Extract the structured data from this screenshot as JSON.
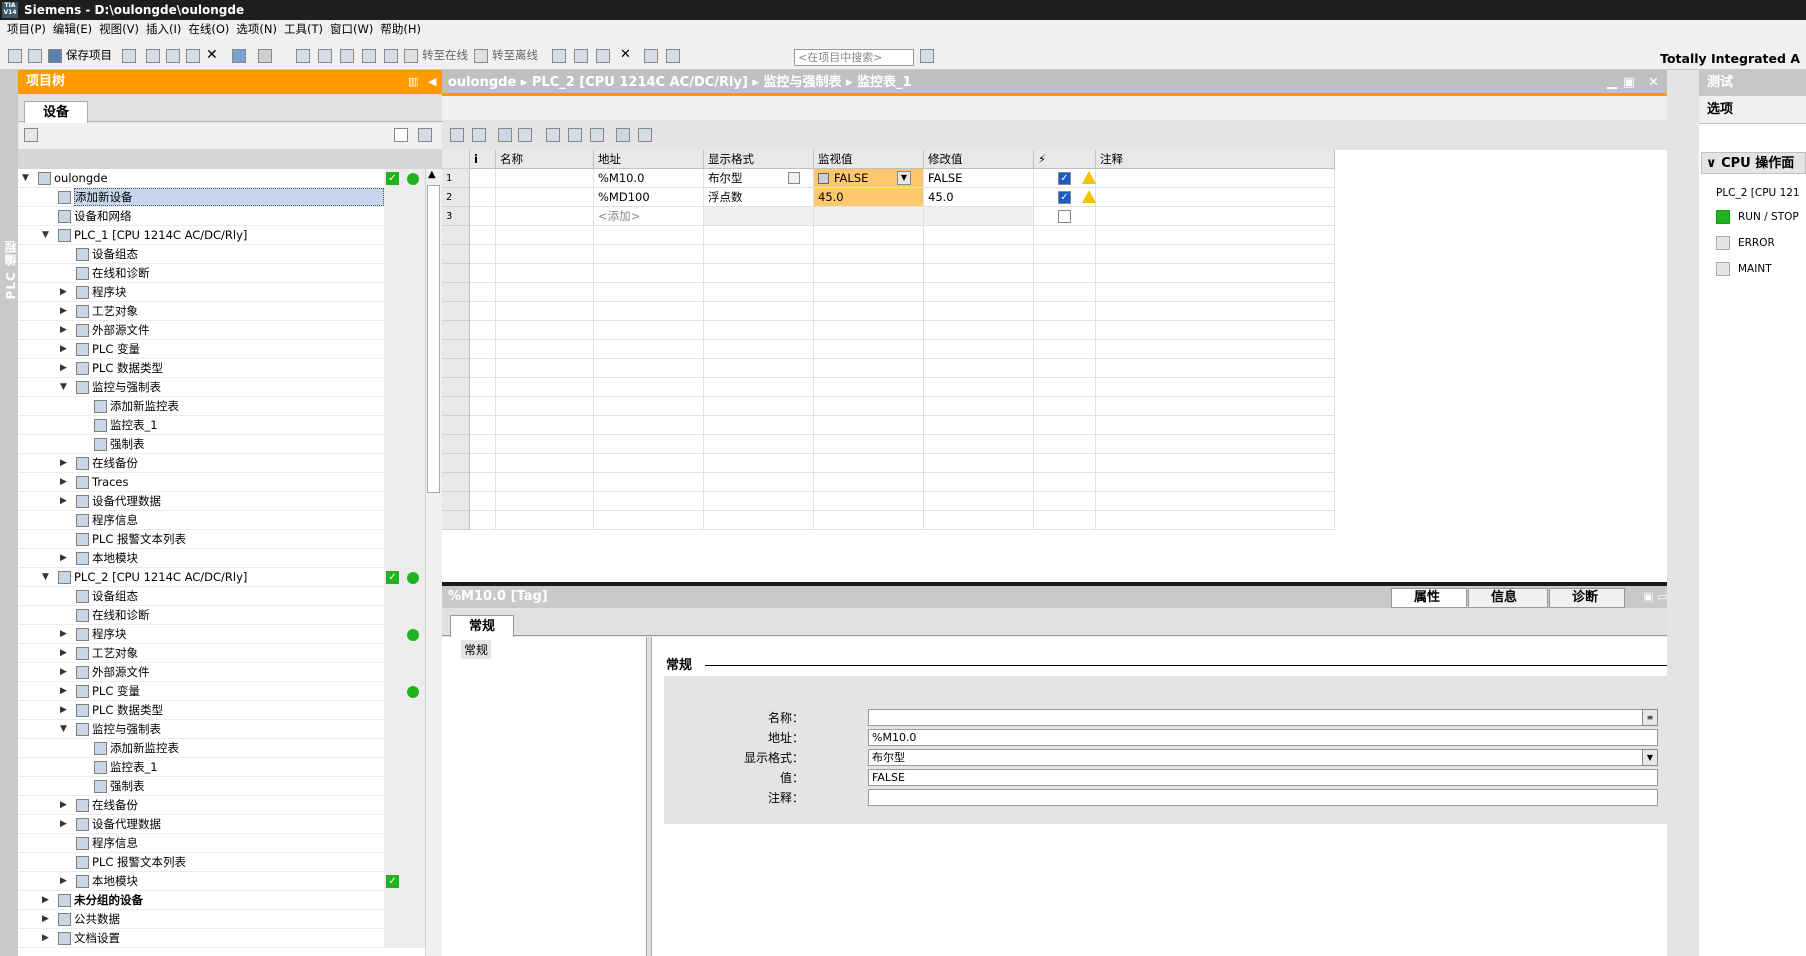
{
  "app": {
    "logo_top": "TIA",
    "logo_bottom": "V14",
    "title": "Siemens  -  D:\\oulongde\\oulongde",
    "brand": "Totally Integrated A"
  },
  "menu": [
    "项目(P)",
    "编辑(E)",
    "视图(V)",
    "插入(I)",
    "在线(O)",
    "选项(N)",
    "工具(T)",
    "窗口(W)",
    "帮助(H)"
  ],
  "toolbar": {
    "save_label": "保存项目",
    "go_online": "转至在线",
    "go_offline": "转至离线",
    "search_placeholder": "<在项目中搜索>"
  },
  "left_strip_label": "PLC 编程",
  "project_tree": {
    "title": "项目树",
    "tab": "设备",
    "items": [
      {
        "label": "oulongde",
        "level": 0,
        "toggle": "▼",
        "check": true,
        "dot": true
      },
      {
        "label": "添加新设备",
        "level": 1,
        "toggle": "",
        "selected": true
      },
      {
        "label": "设备和网络",
        "level": 1,
        "toggle": ""
      },
      {
        "label": "PLC_1 [CPU 1214C AC/DC/Rly]",
        "level": 1,
        "toggle": "▼"
      },
      {
        "label": "设备组态",
        "level": 2,
        "toggle": ""
      },
      {
        "label": "在线和诊断",
        "level": 2,
        "toggle": ""
      },
      {
        "label": "程序块",
        "level": 2,
        "toggle": "▶"
      },
      {
        "label": "工艺对象",
        "level": 2,
        "toggle": "▶"
      },
      {
        "label": "外部源文件",
        "level": 2,
        "toggle": "▶"
      },
      {
        "label": "PLC 变量",
        "level": 2,
        "toggle": "▶"
      },
      {
        "label": "PLC 数据类型",
        "level": 2,
        "toggle": "▶"
      },
      {
        "label": "监控与强制表",
        "level": 2,
        "toggle": "▼"
      },
      {
        "label": "添加新监控表",
        "level": 3,
        "toggle": ""
      },
      {
        "label": "监控表_1",
        "level": 3,
        "toggle": ""
      },
      {
        "label": "强制表",
        "level": 3,
        "toggle": ""
      },
      {
        "label": "在线备份",
        "level": 2,
        "toggle": "▶"
      },
      {
        "label": "Traces",
        "level": 2,
        "toggle": "▶"
      },
      {
        "label": "设备代理数据",
        "level": 2,
        "toggle": "▶"
      },
      {
        "label": "程序信息",
        "level": 2,
        "toggle": ""
      },
      {
        "label": "PLC 报警文本列表",
        "level": 2,
        "toggle": ""
      },
      {
        "label": "本地模块",
        "level": 2,
        "toggle": "▶"
      },
      {
        "label": "PLC_2 [CPU 1214C AC/DC/Rly]",
        "level": 1,
        "toggle": "▼",
        "check": true,
        "dot": true
      },
      {
        "label": "设备组态",
        "level": 2,
        "toggle": ""
      },
      {
        "label": "在线和诊断",
        "level": 2,
        "toggle": ""
      },
      {
        "label": "程序块",
        "level": 2,
        "toggle": "▶",
        "dot": true
      },
      {
        "label": "工艺对象",
        "level": 2,
        "toggle": "▶"
      },
      {
        "label": "外部源文件",
        "level": 2,
        "toggle": "▶"
      },
      {
        "label": "PLC 变量",
        "level": 2,
        "toggle": "▶",
        "dot": true
      },
      {
        "label": "PLC 数据类型",
        "level": 2,
        "toggle": "▶"
      },
      {
        "label": "监控与强制表",
        "level": 2,
        "toggle": "▼"
      },
      {
        "label": "添加新监控表",
        "level": 3,
        "toggle": ""
      },
      {
        "label": "监控表_1",
        "level": 3,
        "toggle": ""
      },
      {
        "label": "强制表",
        "level": 3,
        "toggle": ""
      },
      {
        "label": "在线备份",
        "level": 2,
        "toggle": "▶"
      },
      {
        "label": "设备代理数据",
        "level": 2,
        "toggle": "▶"
      },
      {
        "label": "程序信息",
        "level": 2,
        "toggle": ""
      },
      {
        "label": "PLC 报警文本列表",
        "level": 2,
        "toggle": ""
      },
      {
        "label": "本地模块",
        "level": 2,
        "toggle": "▶",
        "check": true
      },
      {
        "label": "未分组的设备",
        "level": 1,
        "toggle": "▶",
        "bold": true
      },
      {
        "label": "公共数据",
        "level": 1,
        "toggle": "▶"
      },
      {
        "label": "文档设置",
        "level": 1,
        "toggle": "▶"
      }
    ]
  },
  "editor": {
    "breadcrumb": "oulongde  ▸  PLC_2 [CPU 1214C AC/DC/Rly]  ▸  监控与强制表  ▸  监控表_1",
    "columns": [
      "i",
      "名称",
      "地址",
      "显示格式",
      "监视值",
      "修改值",
      "⚡",
      "注释"
    ],
    "rows": [
      {
        "n": "1",
        "address": "%M10.0",
        "format": "布尔型",
        "monitor": "FALSE",
        "modify": "FALSE",
        "checked": true,
        "warn": true
      },
      {
        "n": "2",
        "address": "%MD100",
        "format": "浮点数",
        "monitor": "45.0",
        "modify": "45.0",
        "checked": true,
        "warn": true
      },
      {
        "n": "3",
        "address": "<添加>",
        "format": "",
        "monitor": "",
        "modify": "",
        "checked": false,
        "warn": false
      }
    ]
  },
  "inspector": {
    "title": "%M10.0 [Tag]",
    "tabs": [
      "属性",
      "信息",
      "诊断"
    ],
    "section_tab": "常规",
    "nav_item": "常规",
    "section_title": "常规",
    "fields": [
      {
        "label": "名称：",
        "value": ""
      },
      {
        "label": "地址：",
        "value": "%M10.0"
      },
      {
        "label": "显示格式：",
        "value": "布尔型"
      },
      {
        "label": "值：",
        "value": "FALSE"
      },
      {
        "label": "注释：",
        "value": ""
      }
    ]
  },
  "right_panel": {
    "title": "测试",
    "sub": "选项",
    "cpu_section": "CPU 操作面",
    "plc_label": "PLC_2 [CPU 121",
    "leds": [
      {
        "label": "RUN / STOP",
        "on": true
      },
      {
        "label": "ERROR",
        "on": false
      },
      {
        "label": "MAINT",
        "on": false
      }
    ]
  }
}
